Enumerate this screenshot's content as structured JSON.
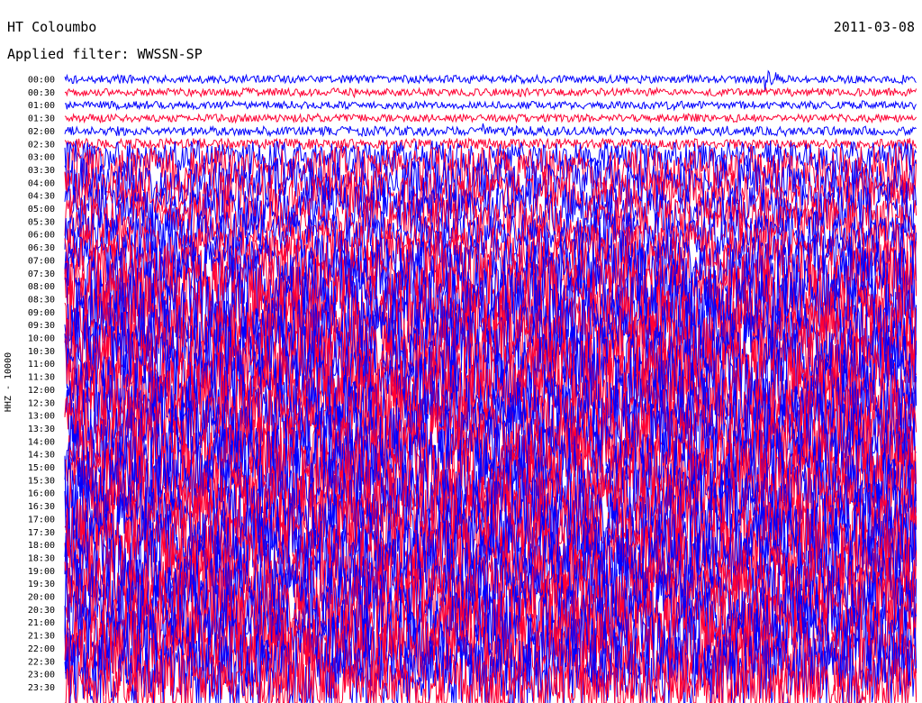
{
  "header": {
    "station": "HT Coloumbo",
    "date": "2011-03-08",
    "filter": "Applied filter: WWSSN-SP"
  },
  "colors": {
    "trace_a": "#0000ff",
    "trace_b": "#ff0033",
    "background": "#ffffff",
    "text": "#000000"
  },
  "chart_data": {
    "type": "line",
    "title": "HT Coloumbo",
    "ylabel": "HHZ - 10000",
    "xlabel": "",
    "grid": false,
    "legend": "none",
    "y_tick_labels": [
      "00:00",
      "00:30",
      "01:00",
      "01:30",
      "02:00",
      "02:30",
      "03:00",
      "03:30",
      "04:00",
      "04:30",
      "05:00",
      "05:30",
      "06:00",
      "06:30",
      "07:00",
      "07:30",
      "08:00",
      "08:30",
      "09:00",
      "09:30",
      "10:00",
      "10:30",
      "11:00",
      "11:30",
      "12:00",
      "12:30",
      "13:00",
      "13:30",
      "14:00",
      "14:30",
      "15:00",
      "15:30",
      "16:00",
      "16:30",
      "17:00",
      "17:30",
      "18:00",
      "18:30",
      "19:00",
      "19:30",
      "20:00",
      "20:30",
      "21:00",
      "21:30",
      "22:00",
      "22:30",
      "23:00",
      "23:30"
    ],
    "series": [
      {
        "label": "00:00",
        "color": "#0000ff",
        "amplitude": 0.3,
        "events": [
          {
            "at": 0.82,
            "peak": 1.3
          }
        ]
      },
      {
        "label": "00:30",
        "color": "#ff0033",
        "amplitude": 0.3,
        "events": [
          {
            "at": 0.34,
            "peak": 0.5
          }
        ]
      },
      {
        "label": "01:00",
        "color": "#0000ff",
        "amplitude": 0.3,
        "events": []
      },
      {
        "label": "01:30",
        "color": "#ff0033",
        "amplitude": 0.3,
        "events": []
      },
      {
        "label": "02:00",
        "color": "#0000ff",
        "amplitude": 0.35,
        "events": [
          {
            "at": 0.49,
            "peak": 0.8
          }
        ]
      },
      {
        "label": "02:30",
        "color": "#ff0033",
        "amplitude": 0.4,
        "events": []
      },
      {
        "label": "03:00",
        "color": "#0000ff",
        "amplitude": 1.2,
        "events": []
      },
      {
        "label": "03:30",
        "color": "#ff0033",
        "amplitude": 1.8,
        "events": []
      },
      {
        "label": "04:00",
        "color": "#0000ff",
        "amplitude": 1.8,
        "events": []
      },
      {
        "label": "04:30",
        "color": "#ff0033",
        "amplitude": 1.8,
        "events": []
      },
      {
        "label": "05:00",
        "color": "#0000ff",
        "amplitude": 1.8,
        "events": []
      },
      {
        "label": "05:30",
        "color": "#ff0033",
        "amplitude": 1.8,
        "events": []
      },
      {
        "label": "06:00",
        "color": "#0000ff",
        "amplitude": 1.8,
        "events": []
      },
      {
        "label": "06:30",
        "color": "#ff0033",
        "amplitude": 1.8,
        "events": []
      },
      {
        "label": "07:00",
        "color": "#0000ff",
        "amplitude": 2.2,
        "events": []
      },
      {
        "label": "07:30",
        "color": "#ff0033",
        "amplitude": 2.5,
        "events": []
      },
      {
        "label": "08:00",
        "color": "#0000ff",
        "amplitude": 3.0,
        "events": []
      },
      {
        "label": "08:30",
        "color": "#ff0033",
        "amplitude": 3.0,
        "events": []
      },
      {
        "label": "09:00",
        "color": "#0000ff",
        "amplitude": 3.0,
        "events": []
      },
      {
        "label": "09:30",
        "color": "#ff0033",
        "amplitude": 3.0,
        "events": []
      },
      {
        "label": "10:00",
        "color": "#0000ff",
        "amplitude": 3.0,
        "events": []
      },
      {
        "label": "10:30",
        "color": "#ff0033",
        "amplitude": 3.0,
        "events": []
      },
      {
        "label": "11:00",
        "color": "#0000ff",
        "amplitude": 3.0,
        "events": []
      },
      {
        "label": "11:30",
        "color": "#ff0033",
        "amplitude": 3.0,
        "events": []
      },
      {
        "label": "12:00",
        "color": "#0000ff",
        "amplitude": 3.0,
        "events": []
      },
      {
        "label": "12:30",
        "color": "#ff0033",
        "amplitude": 3.0,
        "events": []
      },
      {
        "label": "13:00",
        "color": "#0000ff",
        "amplitude": 3.0,
        "events": []
      },
      {
        "label": "13:30",
        "color": "#ff0033",
        "amplitude": 3.0,
        "events": []
      },
      {
        "label": "14:00",
        "color": "#0000ff",
        "amplitude": 3.0,
        "events": []
      },
      {
        "label": "14:30",
        "color": "#ff0033",
        "amplitude": 3.0,
        "events": []
      },
      {
        "label": "15:00",
        "color": "#0000ff",
        "amplitude": 3.0,
        "events": []
      },
      {
        "label": "15:30",
        "color": "#ff0033",
        "amplitude": 3.0,
        "events": []
      },
      {
        "label": "16:00",
        "color": "#0000ff",
        "amplitude": 3.0,
        "events": []
      },
      {
        "label": "16:30",
        "color": "#ff0033",
        "amplitude": 3.0,
        "events": []
      },
      {
        "label": "17:00",
        "color": "#0000ff",
        "amplitude": 3.0,
        "events": []
      },
      {
        "label": "17:30",
        "color": "#ff0033",
        "amplitude": 3.0,
        "events": []
      },
      {
        "label": "18:00",
        "color": "#0000ff",
        "amplitude": 3.0,
        "events": []
      },
      {
        "label": "18:30",
        "color": "#ff0033",
        "amplitude": 3.0,
        "events": []
      },
      {
        "label": "19:00",
        "color": "#0000ff",
        "amplitude": 3.0,
        "events": []
      },
      {
        "label": "19:30",
        "color": "#ff0033",
        "amplitude": 3.0,
        "events": []
      },
      {
        "label": "20:00",
        "color": "#0000ff",
        "amplitude": 3.0,
        "events": []
      },
      {
        "label": "20:30",
        "color": "#ff0033",
        "amplitude": 3.0,
        "events": []
      },
      {
        "label": "21:00",
        "color": "#0000ff",
        "amplitude": 3.0,
        "events": []
      },
      {
        "label": "21:30",
        "color": "#ff0033",
        "amplitude": 3.0,
        "events": []
      },
      {
        "label": "22:00",
        "color": "#0000ff",
        "amplitude": 3.0,
        "events": []
      },
      {
        "label": "22:30",
        "color": "#ff0033",
        "amplitude": 3.0,
        "events": []
      },
      {
        "label": "23:00",
        "color": "#0000ff",
        "amplitude": 3.0,
        "events": [
          {
            "at": 0.27,
            "peak": 4.0
          }
        ]
      },
      {
        "label": "23:30",
        "color": "#ff0033",
        "amplitude": 2.5,
        "events": []
      }
    ]
  }
}
